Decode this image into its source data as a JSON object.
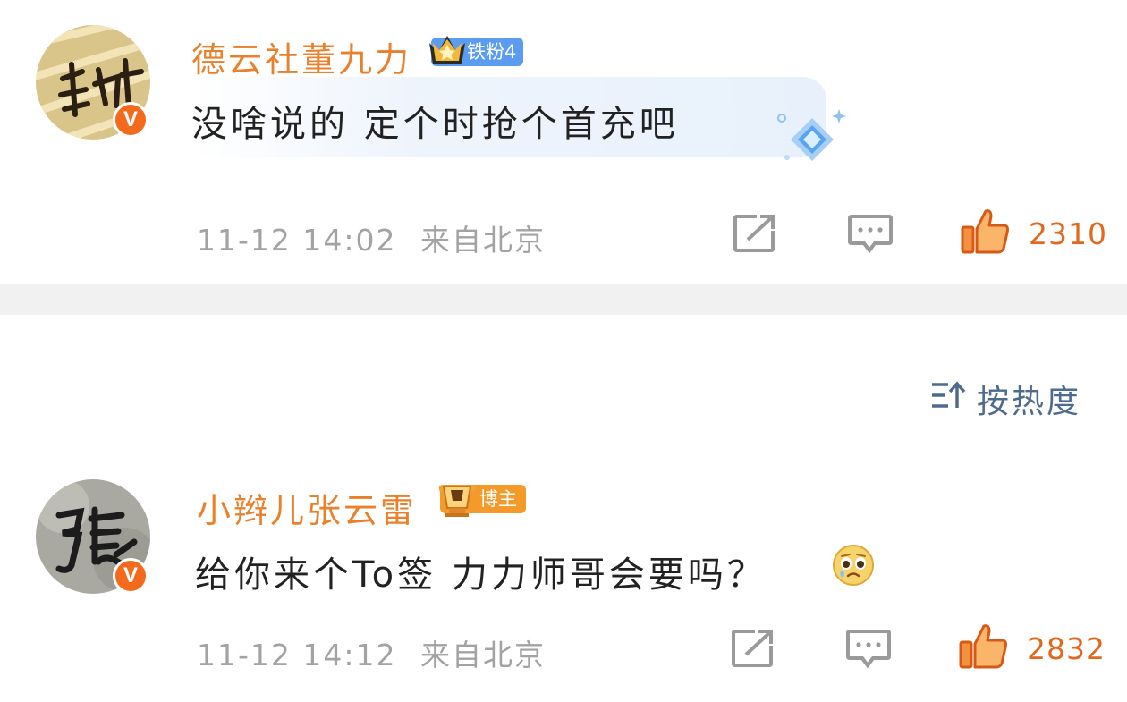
{
  "comments": [
    {
      "username": "德云社董九力",
      "fan_badge": "铁粉4",
      "text": "没啥说的 定个时抢个首充吧",
      "time": "11-12 14:02",
      "location": "来自北京",
      "likes": "2310",
      "verified": "V"
    },
    {
      "username": "小辫儿张云雷",
      "fan_badge": "博主",
      "text": "给你来个To签 力力师哥会要吗？",
      "time": "11-12 14:12",
      "location": "来自北京",
      "likes": "2832",
      "verified": "V"
    }
  ],
  "sort": {
    "label": "按热度"
  },
  "colors": {
    "username": "#e8802c",
    "like": "#e0691f",
    "meta": "#a3a3a3",
    "link": "#4f6b8c"
  }
}
